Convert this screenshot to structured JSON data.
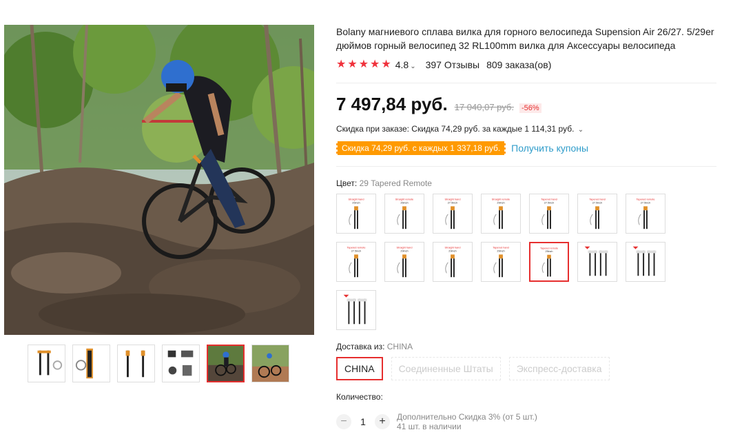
{
  "product": {
    "title": "Bolany магниевого сплава вилка для горного велосипеда Supension Air 26/27. 5/29er дюймов горный велосипед 32 RL100mm вилка для Аксессуары велосипеда",
    "rating": "4.8",
    "reviews": "397 Отзывы",
    "orders": "809 заказа(ов)",
    "price": "7 497,84 руб.",
    "old_price": "17 040,07 руб.",
    "discount": "-56%",
    "order_discount": "Скидка при заказе: Скидка 74,29 руб. за каждые 1 114,31 руб.",
    "coupon": "Скидка 74,29 руб. с каждых 1 337,18 руб.",
    "get_coupons": "Получить купоны"
  },
  "gallery": {
    "main_image_icon": "mountain-biker-photo",
    "thumbnails": [
      {
        "icon": "fork-kit-image"
      },
      {
        "icon": "fork-closeup-image"
      },
      {
        "icon": "fork-pair-image"
      },
      {
        "icon": "fork-parts-image"
      },
      {
        "icon": "biker-photo-image",
        "selected": true
      },
      {
        "icon": "biker-photo-2-image"
      }
    ]
  },
  "color": {
    "label": "Цвет:",
    "value": "29 Tapered Remote",
    "swatches": [
      {
        "caption": "Straight hand 26inch"
      },
      {
        "caption": "Straight remote 26inch"
      },
      {
        "caption": "Straight hand 27.5inch"
      },
      {
        "caption": "Straight remote 29inch"
      },
      {
        "caption": "Tapered hand 27.5inch"
      },
      {
        "caption": "Tapered hand 27.5inch"
      },
      {
        "caption": "Tapered remote 27.5inch"
      },
      {
        "caption": "Tapered remote 27.5inch"
      },
      {
        "caption": "Straight hand 29inch"
      },
      {
        "caption": "Straight hand 29inch"
      },
      {
        "caption": "Tapered hand 29inch"
      },
      {
        "caption": "Tapered remote 29inch",
        "selected": true
      },
      {
        "caption": ""
      },
      {
        "caption": ""
      },
      {
        "caption": ""
      }
    ]
  },
  "shipping": {
    "label": "Доставка из:",
    "value": "CHINA",
    "options": [
      "CHINA",
      "Соединенные Штаты",
      "Экспресс-доставка"
    ]
  },
  "quantity": {
    "label": "Количество:",
    "minus": "−",
    "value": "1",
    "plus": "+",
    "note": "Дополнительно Скидка 3% (от 5 шт.)",
    "stock": "41 шт. в наличии"
  },
  "colors": {
    "accent": "#e62e2e",
    "star": "#f0323c",
    "coupon_bg": "#ff9a00",
    "link": "#2e9cca"
  }
}
